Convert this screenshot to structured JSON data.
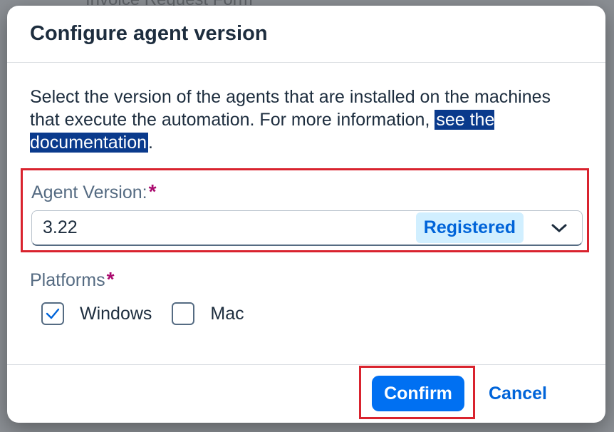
{
  "backdrop": {
    "text": "Invoice Request Form"
  },
  "dialog": {
    "title": "Configure agent version",
    "description": "Select the version of the agents that are installed on the machines that execute the automation. For more information, ",
    "link_text": "see the documentation",
    "description_end": "."
  },
  "agent_version": {
    "label": "Agent Version:",
    "required_mark": "*",
    "value": "3.22",
    "badge": "Registered",
    "chevron_icon": "chevron-down-icon"
  },
  "platforms": {
    "label": "Platforms",
    "required_mark": "*",
    "options": [
      {
        "label": "Windows",
        "checked": true
      },
      {
        "label": "Mac",
        "checked": false
      }
    ]
  },
  "footer": {
    "confirm_label": "Confirm",
    "cancel_label": "Cancel"
  },
  "colors": {
    "accent": "#0070f2",
    "link_highlight": "#0a3a8c",
    "badge_bg": "#d1efff",
    "required": "#aa0a6e",
    "annotation_box": "#d9232e"
  }
}
